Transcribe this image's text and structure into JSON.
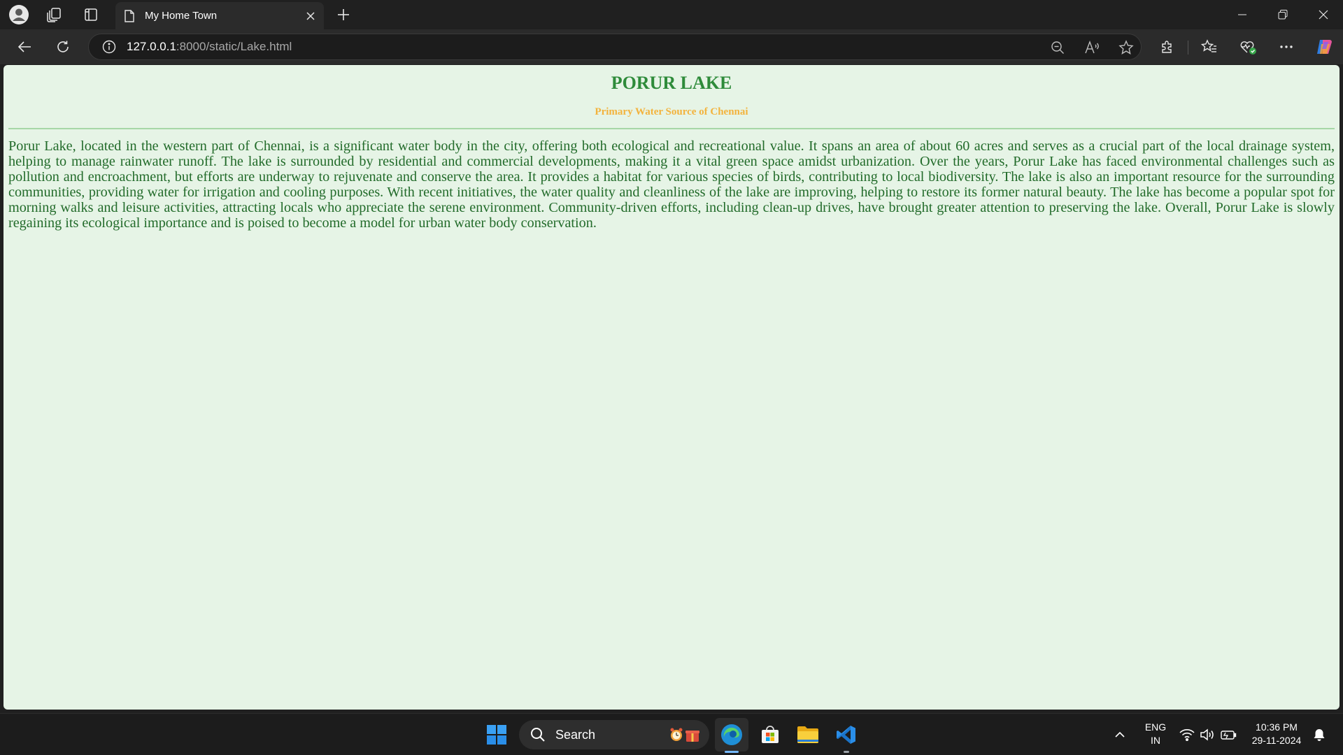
{
  "browser": {
    "tab": {
      "title": "My Home Town"
    },
    "address": {
      "host": "127.0.0.1",
      "rest": ":8000/static/Lake.html"
    }
  },
  "page": {
    "title": "PORUR LAKE",
    "subtitle": "Primary Water Source of Chennai",
    "body": "Porur Lake, located in the western part of Chennai, is a significant water body in the city, offering both ecological and recreational value. It spans an area of about 60 acres and serves as a crucial part of the local drainage system, helping to manage rainwater runoff. The lake is surrounded by residential and commercial developments, making it a vital green space amidst urbanization. Over the years, Porur Lake has faced environmental challenges such as pollution and encroachment, but efforts are underway to rejuvenate and conserve the area. It provides a habitat for various species of birds, contributing to local biodiversity. The lake is also an important resource for the surrounding communities, providing water for irrigation and cooling purposes. With recent initiatives, the water quality and cleanliness of the lake are improving, helping to restore its former natural beauty. The lake has become a popular spot for morning walks and leisure activities, attracting locals who appreciate the serene environment. Community-driven efforts, including clean-up drives, have brought greater attention to preserving the lake. Overall, Porur Lake is slowly regaining its ecological importance and is poised to become a model for urban water body conservation."
  },
  "taskbar": {
    "search_label": "Search",
    "lang_primary": "ENG",
    "lang_secondary": "IN",
    "time": "10:36 PM",
    "date": "29-11-2024"
  },
  "colors": {
    "page_background": "#e6f4e6",
    "title": "#2e8b3a",
    "subtitle": "#f3b33d",
    "body_text": "#226b2a"
  }
}
